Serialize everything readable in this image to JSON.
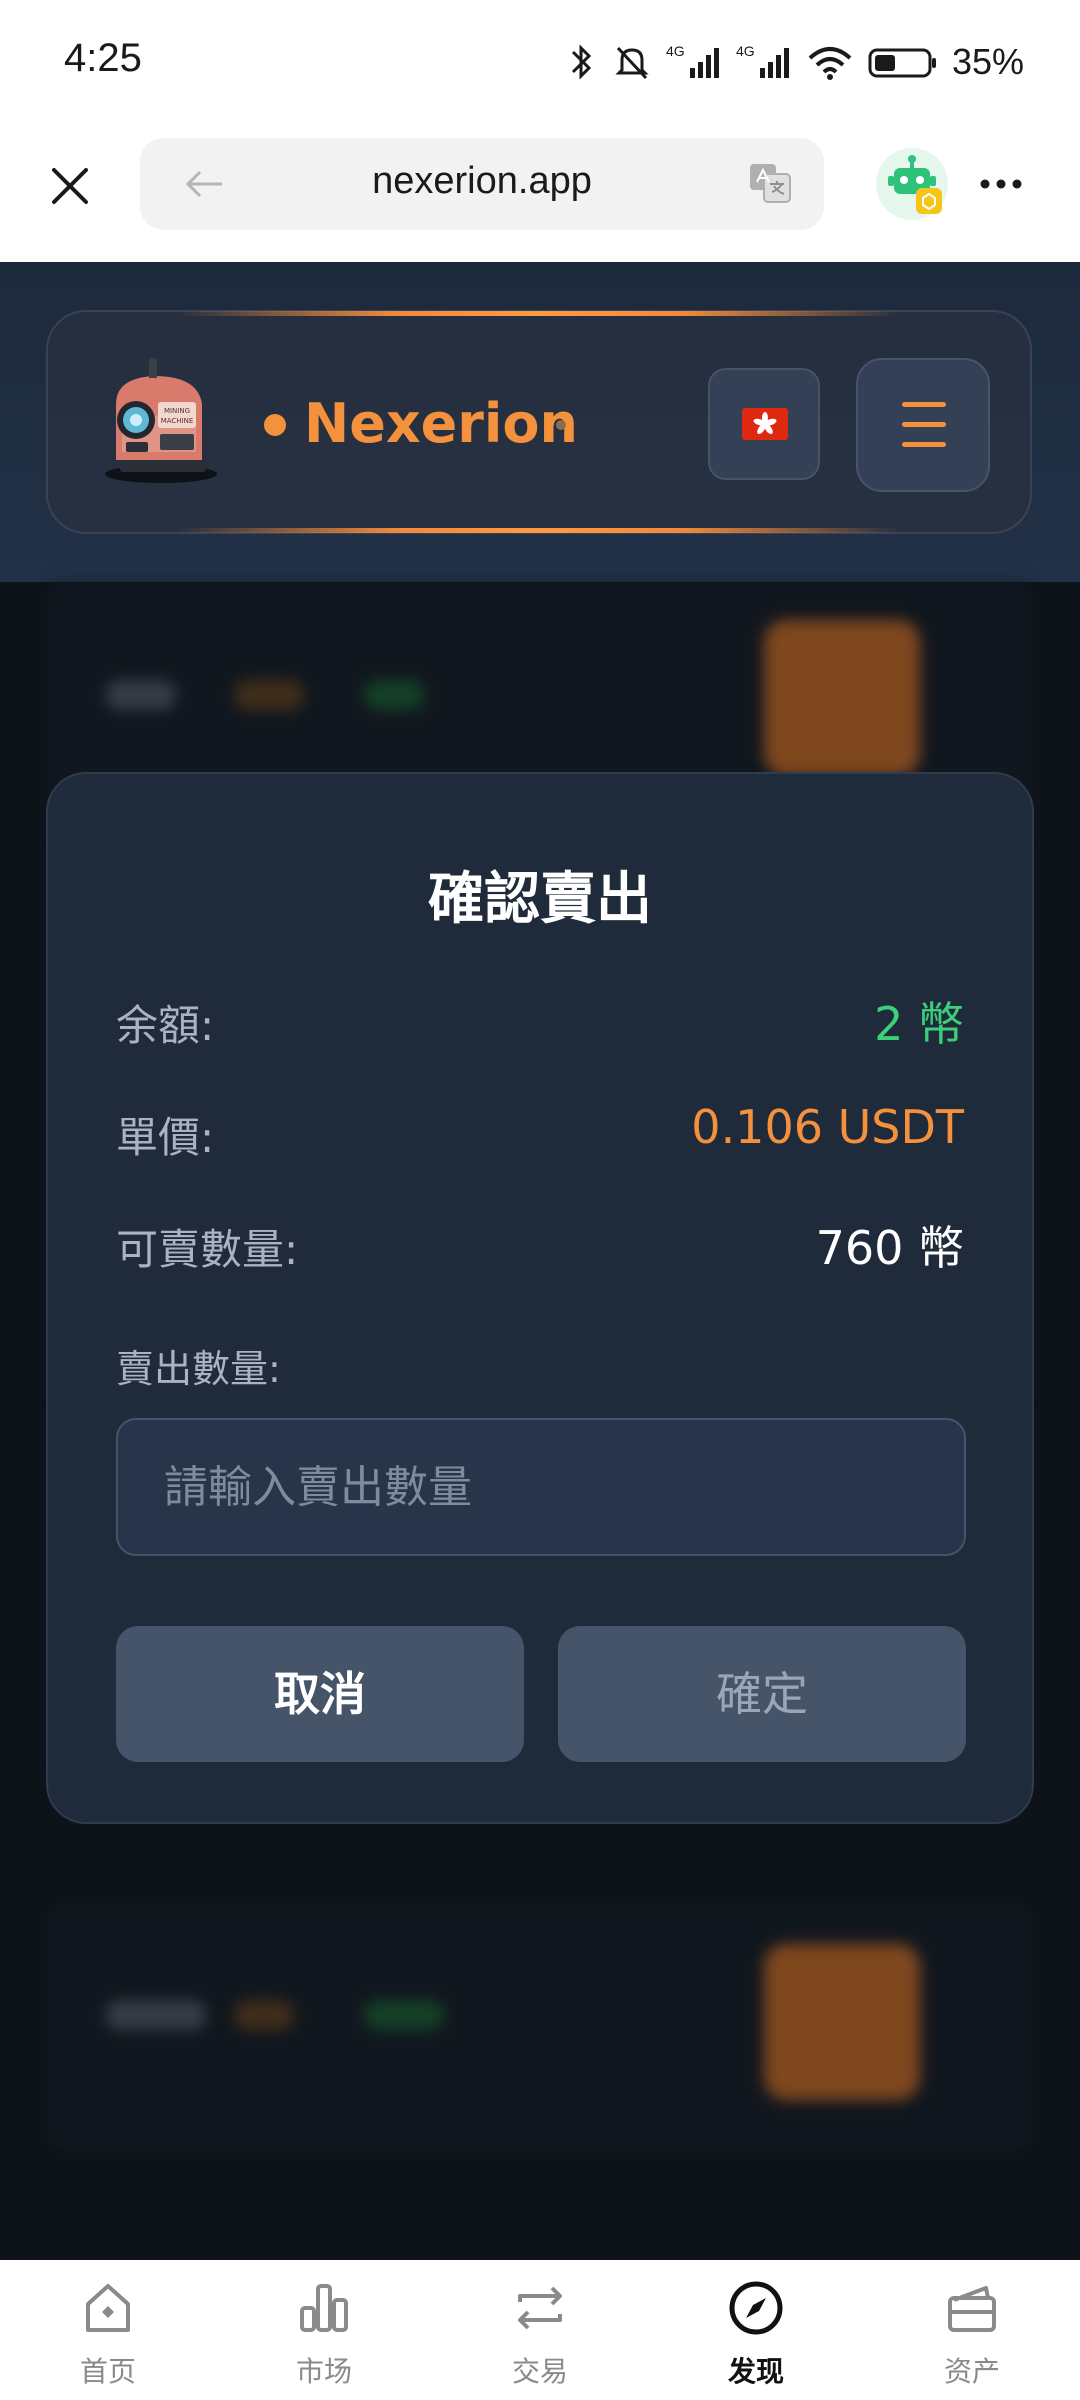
{
  "status_bar": {
    "time": "4:25",
    "network_1": "4G",
    "network_2": "4G",
    "battery": "35%"
  },
  "browser": {
    "url": "nexerion.app"
  },
  "site": {
    "brand": "Nexerion",
    "logo_text": "MINING MACHINE",
    "accent_color": "#f4913d"
  },
  "modal": {
    "title": "確認賣出",
    "balance_label": "余額:",
    "balance_value": "2 幣",
    "price_label": "單價:",
    "price_value": "0.106 USDT",
    "sellable_label": "可賣數量:",
    "sellable_value": "760 幣",
    "quantity_label": "賣出數量:",
    "quantity_placeholder": "請輸入賣出數量",
    "cancel_label": "取消",
    "confirm_label": "確定"
  },
  "bottom_nav": {
    "items": [
      {
        "label": "首页",
        "icon": "home-icon"
      },
      {
        "label": "市场",
        "icon": "market-icon"
      },
      {
        "label": "交易",
        "icon": "trade-icon"
      },
      {
        "label": "发现",
        "icon": "compass-icon",
        "active": true
      },
      {
        "label": "资产",
        "icon": "wallet-icon"
      }
    ]
  }
}
